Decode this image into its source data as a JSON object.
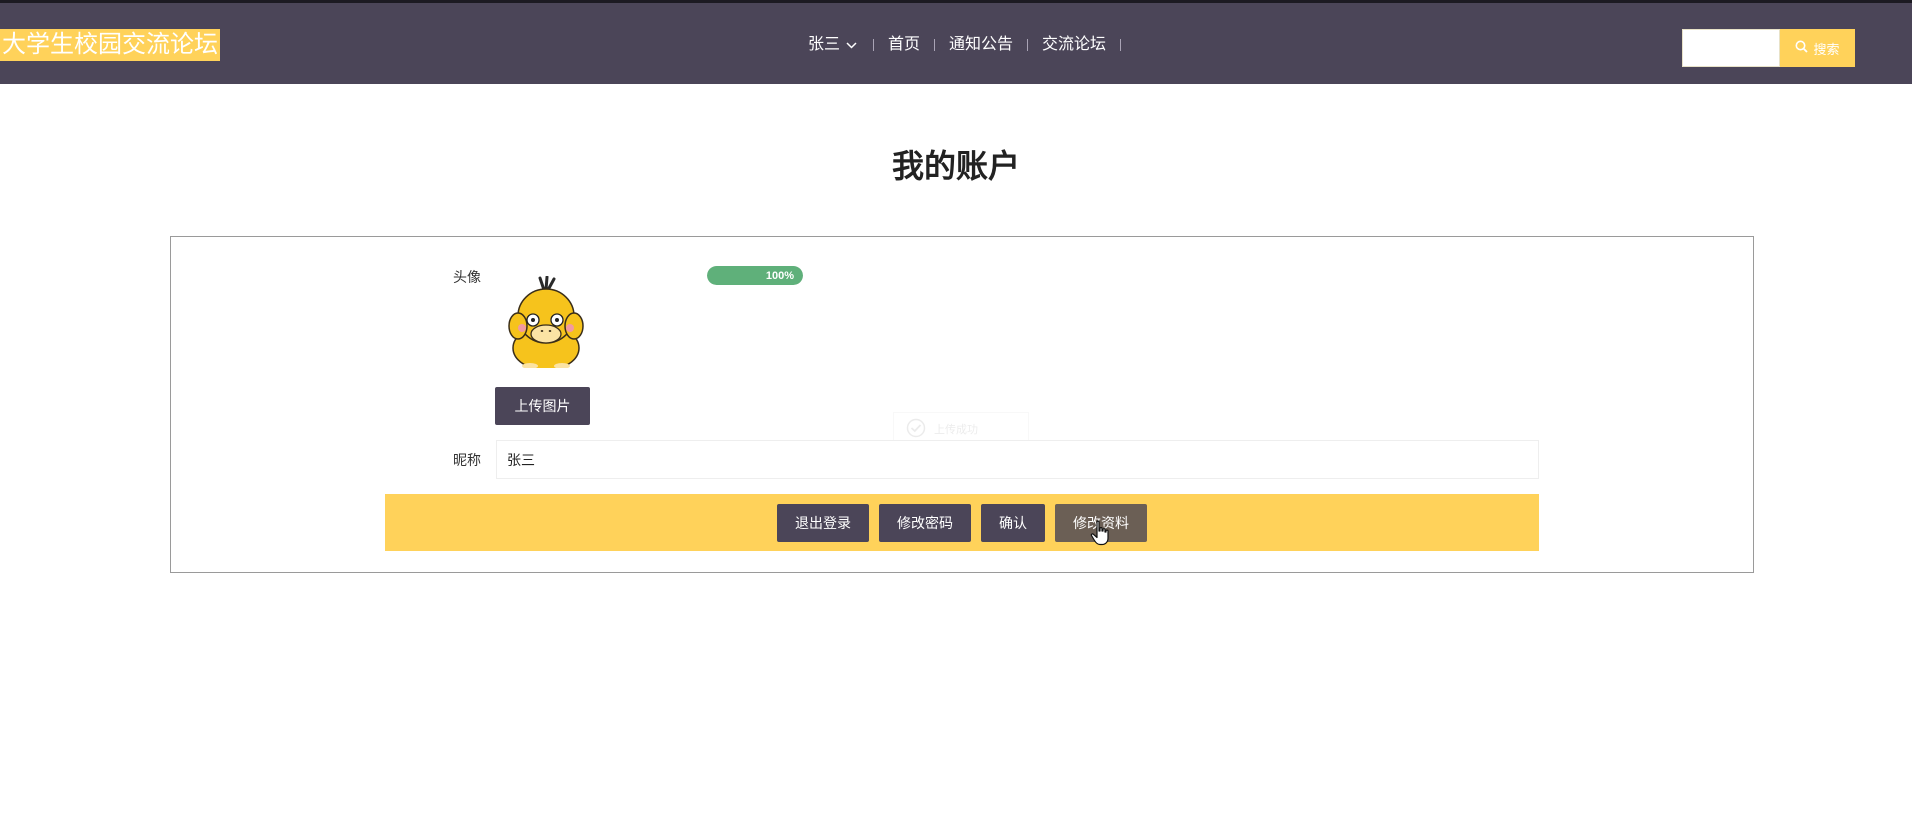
{
  "header": {
    "logo_text": "大学生校园交流论坛",
    "user_menu_label": "张三",
    "nav_items": [
      "首页",
      "通知公告",
      "交流论坛"
    ],
    "search_placeholder": "",
    "search_button_label": "搜索"
  },
  "page": {
    "title": "我的账户"
  },
  "profile": {
    "avatar_label": "头像",
    "upload_progress": 100,
    "upload_progress_text": "100%",
    "upload_button_label": "上传图片",
    "upload_toast_text": "上传成功",
    "nickname_label": "昵称",
    "nickname_value": "张三"
  },
  "actions": {
    "logout_label": "退出登录",
    "change_password_label": "修改密码",
    "confirm_label": "确认",
    "edit_profile_label": "修改资料"
  },
  "colors": {
    "nav_background": "#4b4558",
    "accent_yellow": "#ffd25a",
    "button_dark": "#4b4558",
    "progress_green": "#5fb07a"
  },
  "icons": {
    "user_menu": "chevron-down-icon",
    "search": "search-icon",
    "toast": "check-circle-icon",
    "cursor": "hand-pointer-icon"
  }
}
